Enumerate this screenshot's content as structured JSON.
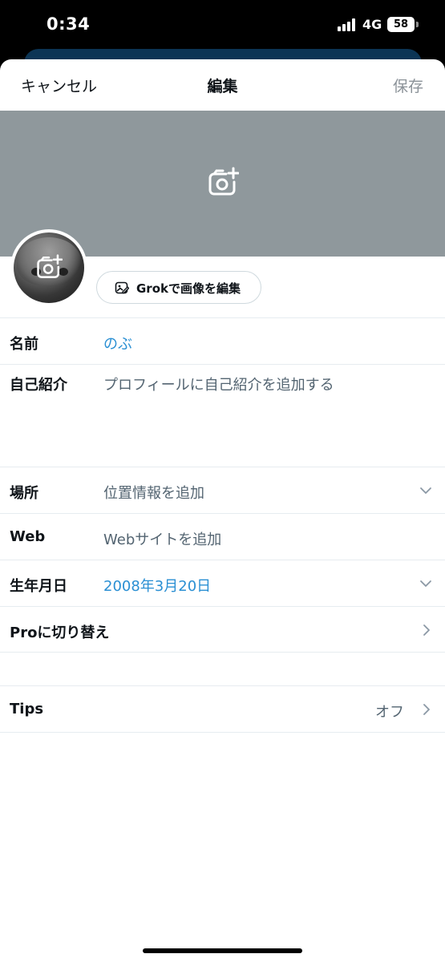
{
  "status_bar": {
    "time": "0:34",
    "network": "4G",
    "battery": "58"
  },
  "nav": {
    "cancel": "キャンセル",
    "title": "編集",
    "save": "保存"
  },
  "header_media": {
    "banner_icon": "camera-plus-icon",
    "avatar_icon": "camera-plus-icon"
  },
  "grok_button": {
    "label": "Grokで画像を編集",
    "icon": "image-edit-icon"
  },
  "fields": {
    "name": {
      "label": "名前",
      "value": "のぶ"
    },
    "bio": {
      "label": "自己紹介",
      "placeholder": "プロフィールに自己紹介を追加する"
    },
    "location": {
      "label": "場所",
      "placeholder": "位置情報を追加"
    },
    "web": {
      "label": "Web",
      "placeholder": "Webサイトを追加"
    },
    "birthday": {
      "label": "生年月日",
      "value": "2008年3月20日"
    },
    "pro": {
      "label": "Proに切り替え"
    },
    "tips": {
      "label": "Tips",
      "value": "オフ"
    }
  },
  "colors": {
    "link_blue": "#2a8fd3",
    "banner_gray": "#8f989c",
    "divider": "#e6ecf0"
  }
}
